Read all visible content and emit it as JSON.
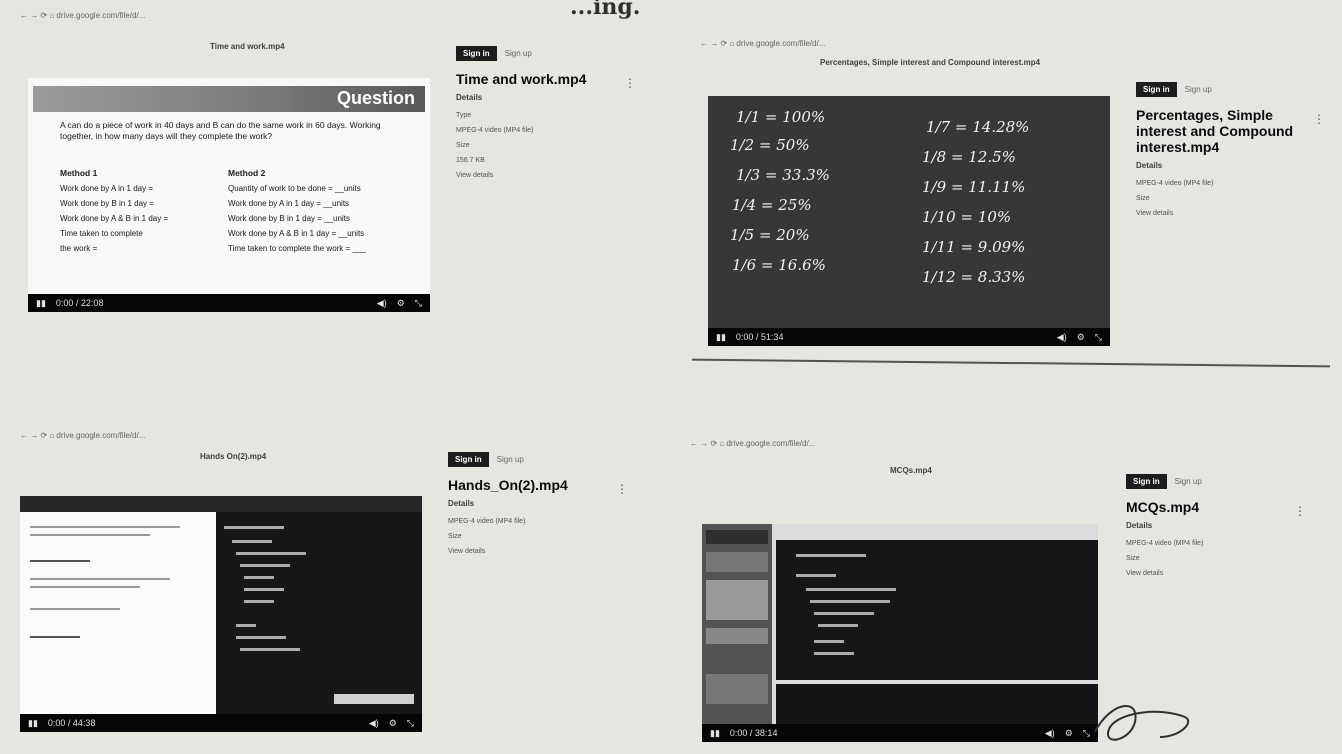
{
  "heading": "...ing.",
  "panels": [
    {
      "address": "← → ⟳ ⌂ drive.google.com/file/d/...",
      "page_title": "Time and work.mp4",
      "side": {
        "sign_in": "Sign in",
        "register": "Sign up",
        "title": "Time and work.mp4",
        "details": "Details",
        "meta": [
          "Type",
          "MPEG-4 video (MP4 file)",
          "Size",
          "156.7 KB",
          "View details"
        ]
      },
      "slide": {
        "question_label": "Question",
        "question_text": "A can do a piece of work in 40 days and B can do the same work in 60 days. Working together, in how many days will they complete the work?",
        "method1_title": "Method 1",
        "method1": [
          "Work done by A in 1 day =",
          "Work done by B in 1 day =",
          "Work done by A & B in 1 day =",
          "Time taken to complete",
          "the work ="
        ],
        "method2_title": "Method 2",
        "method2": [
          "Quantity of work to be done = __units",
          "Work done by A in 1 day = __units",
          "Work done by B in 1 day = __units",
          "Work done by A & B in 1 day = __units",
          "Time taken to complete the work = ___"
        ]
      },
      "time": "0:00 / 22:08"
    },
    {
      "address": "← → ⟳ ⌂ drive.google.com/file/d/...",
      "page_title": "Percentages, Simple interest and Compound interest.mp4",
      "side": {
        "sign_in": "Sign in",
        "register": "Sign up",
        "title": "Percentages, Simple interest and Compound interest.mp4",
        "details": "Details",
        "meta": [
          "MPEG-4 video (MP4 file)",
          "Size",
          "View details"
        ]
      },
      "fractions": [
        "1/1 = 100%",
        "1/2 = 50%",
        "1/3 = 33.3%",
        "1/4 = 25%",
        "1/5 = 20%",
        "1/6 = 16.6%",
        "1/7 = 14.28%",
        "1/8 = 12.5%",
        "1/9 = 11.11%",
        "1/10 = 10%",
        "1/11 = 9.09%",
        "1/12 = 8.33%"
      ],
      "time": "0:00 / 51:34"
    },
    {
      "address": "← → ⟳ ⌂ drive.google.com/file/d/...",
      "page_title": "Hands On(2).mp4",
      "side": {
        "sign_in": "Sign in",
        "register": "Sign up",
        "title": "Hands_On(2).mp4",
        "details": "Details",
        "meta": [
          "MPEG-4 video (MP4 file)",
          "Size",
          "View details"
        ]
      },
      "time": "0:00 / 44:38"
    },
    {
      "address": "← → ⟳ ⌂ drive.google.com/file/d/...",
      "page_title": "MCQs.mp4",
      "side": {
        "sign_in": "Sign in",
        "register": "Sign up",
        "title": "MCQs.mp4",
        "details": "Details",
        "meta": [
          "MPEG-4 video (MP4 file)",
          "Size",
          "View details"
        ]
      },
      "time": "0:00 / 38:14"
    }
  ],
  "controls": {
    "play_icon": "▮▮",
    "volume_icon": "◀)",
    "settings_icon": "⚙",
    "fullscreen_icon": "⤡"
  }
}
